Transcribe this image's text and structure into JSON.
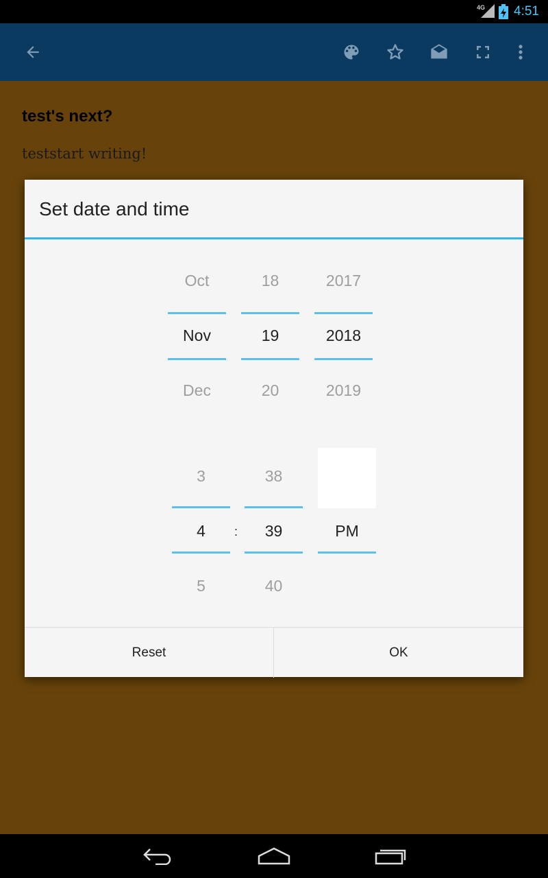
{
  "status_bar": {
    "network": "4G",
    "time": "4:51"
  },
  "app_bar": {
    "icons": [
      "back-arrow-icon",
      "palette-icon",
      "star-icon",
      "envelope-open-icon",
      "fullscreen-icon",
      "overflow-menu-icon"
    ]
  },
  "note": {
    "title": "test's next?",
    "body": "teststart writing!"
  },
  "dialog": {
    "title": "Set date and time",
    "date": {
      "month": {
        "prev": "Oct",
        "selected": "Nov",
        "next": "Dec"
      },
      "day": {
        "prev": "18",
        "selected": "19",
        "next": "20"
      },
      "year": {
        "prev": "2017",
        "selected": "2018",
        "next": "2019"
      }
    },
    "time": {
      "hour": {
        "prev": "3",
        "selected": "4",
        "next": "5"
      },
      "separator": ":",
      "minute": {
        "prev": "38",
        "selected": "39",
        "next": "40"
      },
      "ampm": {
        "selected": "PM"
      }
    },
    "buttons": {
      "reset": "Reset",
      "ok": "OK"
    }
  },
  "colors": {
    "accent": "#33b5e5",
    "app_bar": "#0a3a60",
    "note_bg": "#67430b"
  }
}
